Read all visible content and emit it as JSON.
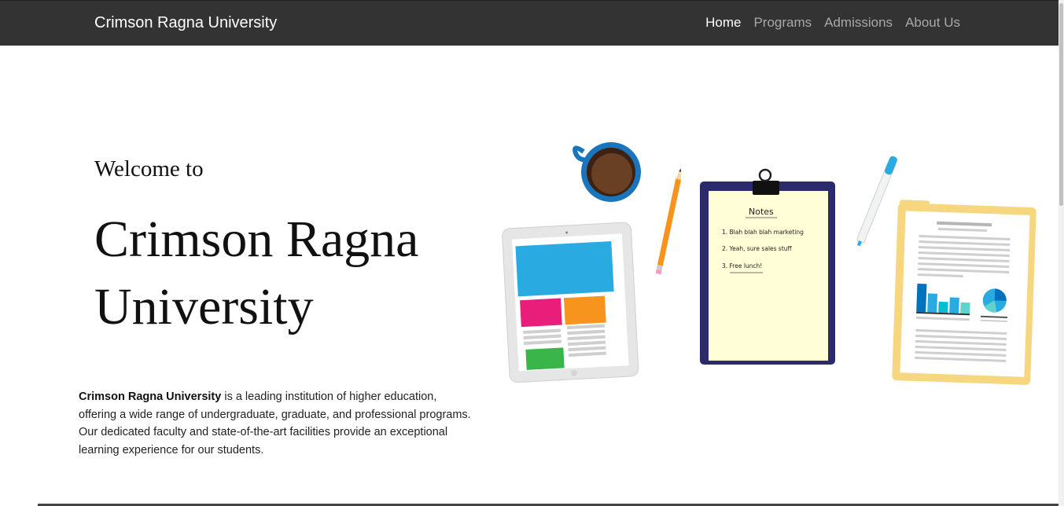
{
  "navbar": {
    "brand": "Crimson Ragna University",
    "items": [
      {
        "label": "Home",
        "active": true
      },
      {
        "label": "Programs",
        "active": false
      },
      {
        "label": "Admissions",
        "active": false
      },
      {
        "label": "About Us",
        "active": false
      }
    ]
  },
  "hero": {
    "welcome": "Welcome to",
    "title": "Crimson Ragna University",
    "intro_bold": "Crimson Ragna University",
    "intro_rest": " is a leading institution of higher education, offering a wide range of undergraduate, graduate, and professional programs.",
    "intro_line2": "Our dedicated faculty and state-of-the-art facilities provide an exceptional learning experience for our students."
  },
  "illustration": {
    "notes_title": "Notes",
    "notes": [
      "1. Blah blah blah marketing",
      "2. Yeah, sure sales stuff",
      "3. Free lunch!"
    ]
  },
  "colors": {
    "navbar_bg": "#333333",
    "nav_active": "#ffffff",
    "nav_inactive": "#a8a8a8"
  }
}
